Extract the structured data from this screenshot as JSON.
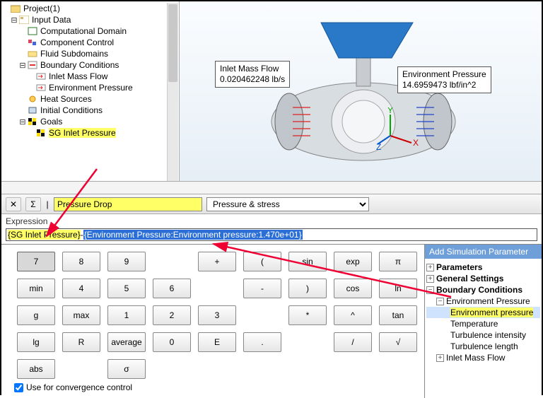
{
  "tree": {
    "root": "Project(1)",
    "n0": "Input Data",
    "n1": "Computational Domain",
    "n2": "Component Control",
    "n3": "Fluid Subdomains",
    "n4": "Boundary Conditions",
    "n5": "Inlet Mass Flow",
    "n6": "Environment Pressure",
    "n7": "Heat Sources",
    "n8": "Initial Conditions",
    "n9": "Goals",
    "n10": "SG Inlet Pressure"
  },
  "callouts": {
    "inlet_title": "Inlet Mass Flow",
    "inlet_value": "0.020462248 lb/s",
    "env_title": "Environment Pressure",
    "env_value": "14.6959473 lbf/in^2"
  },
  "toolbar": {
    "name_value": "Pressure Drop",
    "dim_value": "Pressure & stress"
  },
  "expr": {
    "label": "Expression",
    "part1": "{SG Inlet Pressure}",
    "dash": "-",
    "part2": "{Environment Pressure:Environment pressure:1.470e+01}"
  },
  "calc": {
    "r0": [
      "7",
      "8",
      "9",
      "",
      "+",
      "(",
      "sin",
      "exp",
      "π",
      "min"
    ],
    "r1": [
      "4",
      "5",
      "6",
      "",
      "-",
      ")",
      "cos",
      "ln",
      "g",
      "max"
    ],
    "r2": [
      "1",
      "2",
      "3",
      "",
      "*",
      "^",
      "tan",
      "lg",
      "R",
      "average"
    ],
    "r3": [
      "0",
      "E",
      ".",
      "",
      "/",
      "√",
      "abs",
      "",
      "σ",
      ""
    ]
  },
  "chk_label": "Use for convergence control",
  "side": {
    "title": "Add Simulation Parameter",
    "s0": "Parameters",
    "s1": "General Settings",
    "s2": "Boundary Conditions",
    "s3": "Environment Pressure",
    "s4": "Environment pressure",
    "s5": "Temperature",
    "s6": "Turbulence intensity",
    "s7": "Turbulence length",
    "s8": "Inlet Mass Flow"
  }
}
